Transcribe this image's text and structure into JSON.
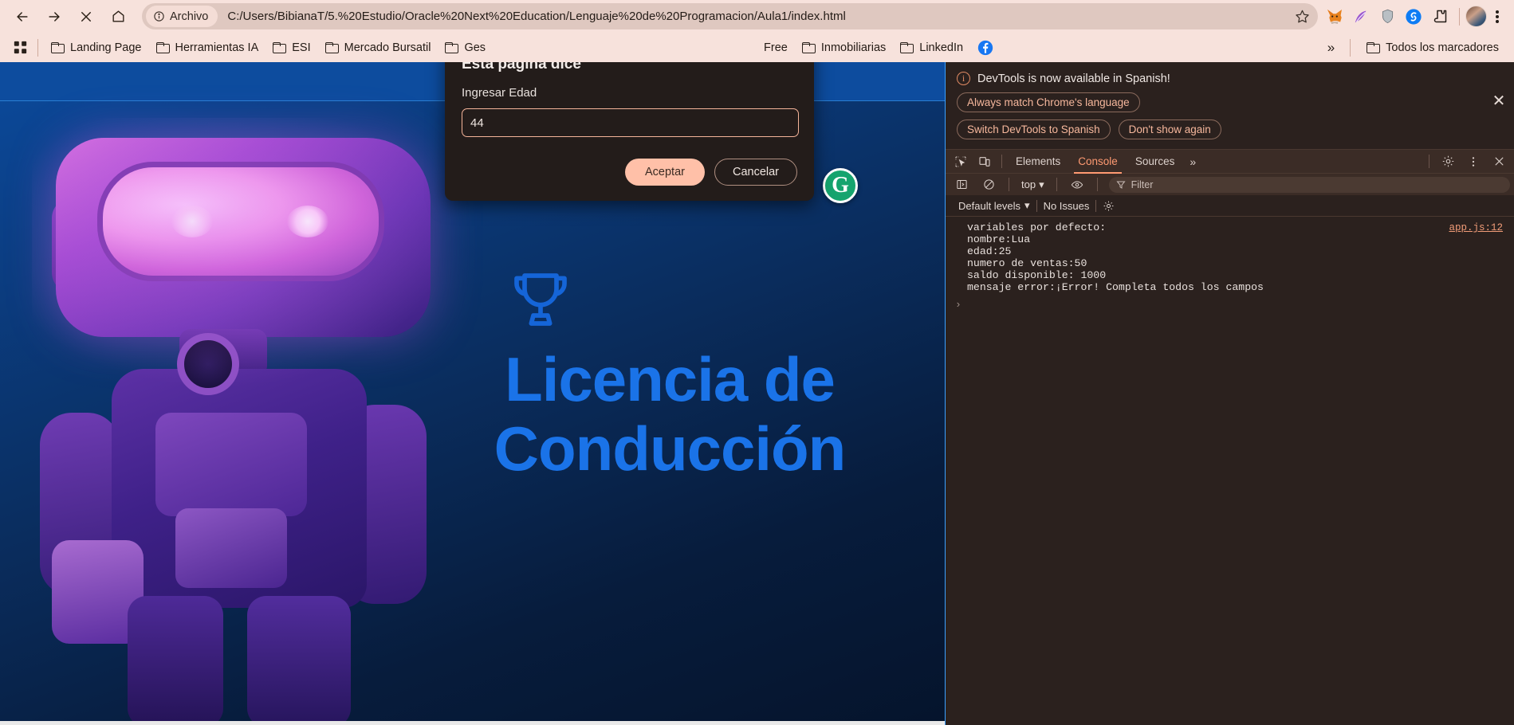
{
  "browser": {
    "nav": {
      "back_icon": "back-arrow-icon",
      "forward_icon": "forward-arrow-icon",
      "stop_icon": "stop-loading-icon",
      "home_icon": "home-icon"
    },
    "omnibox": {
      "file_chip_label": "Archivo",
      "url": "C:/Users/BibianaT/5.%20Estudio/Oracle%20Next%20Education/Lenguaje%20de%20Programacion/Aula1/index.html",
      "bookmark_star": "star-icon"
    },
    "extensions": [
      {
        "name": "metamask-extension-icon",
        "label": "MetaMask"
      },
      {
        "name": "quill-extension-icon",
        "label": "Quill"
      },
      {
        "name": "shield-extension-icon",
        "label": "Shield"
      },
      {
        "name": "shazam-extension-icon",
        "label": "Shazam"
      },
      {
        "name": "extensions-puzzle-icon",
        "label": "Extensiones"
      }
    ],
    "profile_label": "Perfil",
    "menu_label": "Personalizar y controlar Google Chrome"
  },
  "bookmarks": {
    "apps_icon": "apps-grid-icon",
    "items": [
      {
        "label": "Landing Page"
      },
      {
        "label": "Herramientas IA"
      },
      {
        "label": "ESI"
      },
      {
        "label": "Mercado Bursatil"
      },
      {
        "label": "Ges"
      },
      {
        "label": "Free"
      },
      {
        "label": "Inmobiliarias"
      },
      {
        "label": "LinkedIn"
      }
    ],
    "facebook_label": "Facebook",
    "overflow_label": "»",
    "all_bookmarks_label": "Todos los marcadores"
  },
  "page": {
    "title_line1": "Licencia de",
    "title_line2": "Conducción",
    "trophy_icon": "trophy-icon",
    "grammarly_badge": "G",
    "robot_alt": "robot-illustration"
  },
  "dialog": {
    "title": "Esta página dice",
    "message": "Ingresar Edad",
    "input_value": "44",
    "accept_label": "Aceptar",
    "cancel_label": "Cancelar"
  },
  "devtools": {
    "banner": {
      "text": "DevTools is now available in Spanish!",
      "info_icon": "info-icon",
      "buttons": [
        {
          "label": "Always match Chrome's language"
        },
        {
          "label": "Switch DevTools to Spanish"
        },
        {
          "label": "Don't show again"
        }
      ],
      "close_icon": "close-icon"
    },
    "toolbar": {
      "inspect_icon": "inspect-element-icon",
      "device_icon": "device-toolbar-icon",
      "tabs": [
        {
          "label": "Elements",
          "active": false
        },
        {
          "label": "Console",
          "active": true
        },
        {
          "label": "Sources",
          "active": false
        }
      ],
      "more_tabs_label": "»",
      "settings_icon": "gear-icon",
      "kebab_icon": "more-options-icon",
      "close_icon": "close-devtools-icon"
    },
    "filterbar": {
      "sidebar_icon": "console-sidebar-icon",
      "clear_icon": "clear-console-icon",
      "context": "top",
      "eye_icon": "live-expression-icon",
      "filter_icon": "filter-icon",
      "filter_placeholder": "Filter"
    },
    "levelbar": {
      "levels": "Default levels",
      "issues": "No Issues",
      "settings_icon": "console-settings-icon"
    },
    "console_log": {
      "source": "app.js:12",
      "lines": [
        "variables por defecto:",
        "nombre:Lua",
        "edad:25",
        "numero de ventas:50",
        "saldo disponible: 1000",
        "mensaje error:¡Error! Completa todos los campos"
      ],
      "prompt": "›"
    }
  },
  "colors": {
    "chrome_bg": "#f7e2dc",
    "page_blue": "#0b4a9c",
    "title_blue": "#1a73e8",
    "dialog_bg": "#231c1a",
    "accent_peach": "#ffc0a8",
    "devtools_bg": "#2b211e",
    "devtools_accent": "#ff9a72"
  }
}
